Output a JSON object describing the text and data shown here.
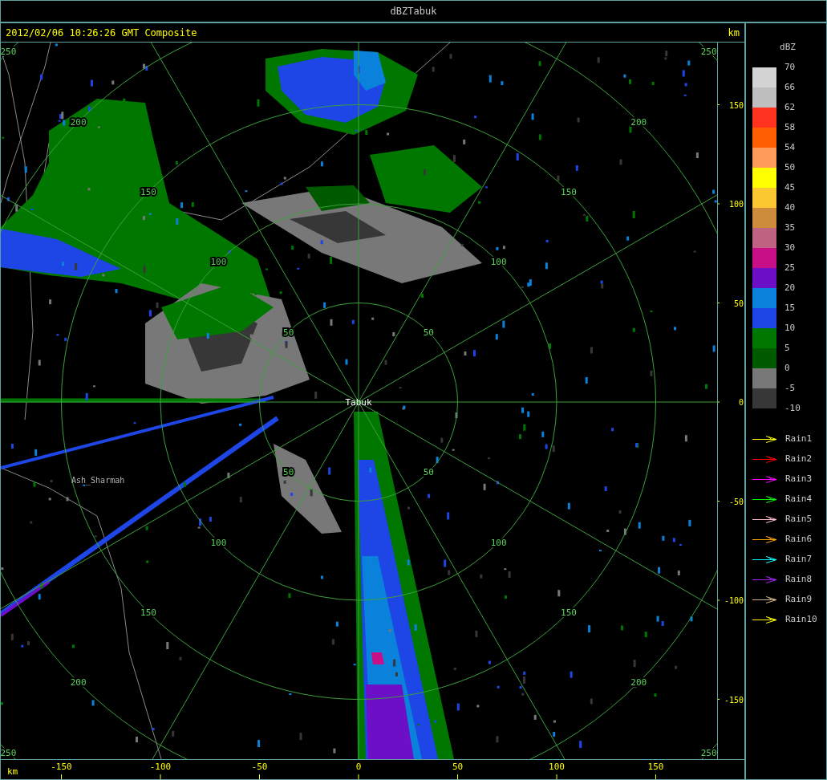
{
  "window": {
    "title": "dBZTabuk"
  },
  "header": {
    "timestamp": "2012/02/06 10:26:26 GMT Composite",
    "unit": "km"
  },
  "plot": {
    "range_rings": [
      {
        "labels": [
          "50",
          "50",
          "50",
          "50"
        ]
      },
      {
        "labels": [
          "100",
          "100",
          "100",
          "100"
        ]
      },
      {
        "labels": [
          "150",
          "150",
          "150",
          "150"
        ]
      },
      {
        "labels": [
          "200",
          "200",
          "200",
          "200"
        ]
      },
      {
        "labels": [
          "250",
          "250",
          "250",
          "250"
        ]
      }
    ],
    "places": [
      {
        "name": "Tabuk",
        "kind": "station"
      },
      {
        "name": "Ash_Sharmah",
        "kind": "town"
      }
    ],
    "y_axis": {
      "ticks": [
        "150",
        "100",
        "50",
        "0",
        "-50",
        "-100",
        "-150"
      ]
    },
    "x_axis": {
      "unit": "km",
      "ticks": [
        "-150",
        "-100",
        "-50",
        "0",
        "50",
        "100",
        "150"
      ]
    }
  },
  "legend": {
    "title": "dBZ",
    "bins": [
      {
        "label": "70",
        "color": "#d3d3d3"
      },
      {
        "label": "66",
        "color": "#bebebe"
      },
      {
        "label": "62",
        "color": "#ff3320"
      },
      {
        "label": "58",
        "color": "#ff5f00"
      },
      {
        "label": "54",
        "color": "#ff9b5a"
      },
      {
        "label": "50",
        "color": "#ffff00"
      },
      {
        "label": "45",
        "color": "#fcc832"
      },
      {
        "label": "40",
        "color": "#cd8c3c"
      },
      {
        "label": "35",
        "color": "#be6482"
      },
      {
        "label": "30",
        "color": "#c80f87"
      },
      {
        "label": "25",
        "color": "#6e0fc8"
      },
      {
        "label": "20",
        "color": "#0a82dc"
      },
      {
        "label": "15",
        "color": "#1e46e6"
      },
      {
        "label": "10",
        "color": "#007800"
      },
      {
        "label": "5",
        "color": "#005a00"
      },
      {
        "label": "0",
        "color": "#787878"
      },
      {
        "label": "-5",
        "color": "#373737"
      }
    ],
    "bottom_label": "-10",
    "tracks": [
      {
        "label": "Rain1",
        "color": "#ffff00"
      },
      {
        "label": "Rain2",
        "color": "#ff0000"
      },
      {
        "label": "Rain3",
        "color": "#ff00ff"
      },
      {
        "label": "Rain4",
        "color": "#00ff00"
      },
      {
        "label": "Rain5",
        "color": "#ffc0cb"
      },
      {
        "label": "Rain6",
        "color": "#ffa500"
      },
      {
        "label": "Rain7",
        "color": "#00ffff"
      },
      {
        "label": "Rain8",
        "color": "#a020f0"
      },
      {
        "label": "Rain9",
        "color": "#d2b48c"
      },
      {
        "label": "Rain10",
        "color": "#ffff00"
      }
    ]
  }
}
